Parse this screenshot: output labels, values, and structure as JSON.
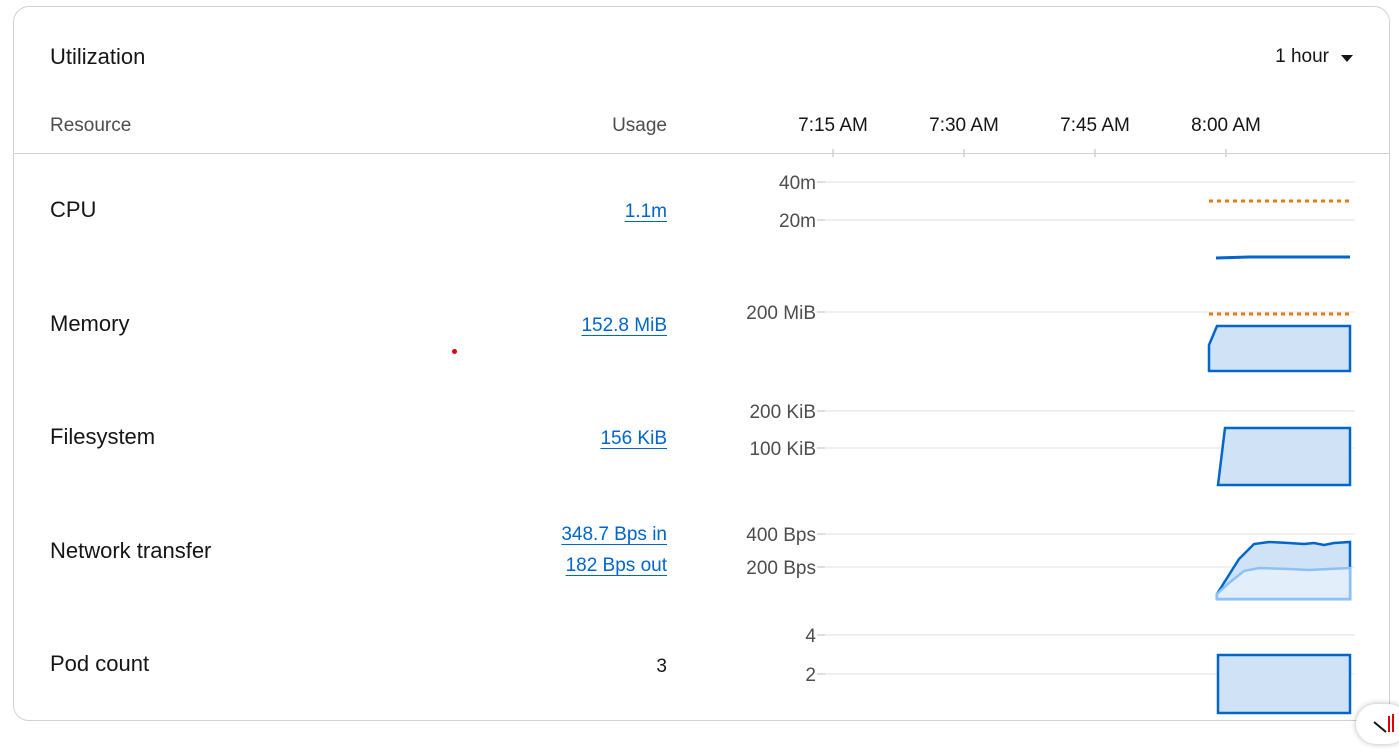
{
  "card": {
    "title": "Utilization",
    "duration": "1 hour"
  },
  "columns": {
    "resource": "Resource",
    "usage": "Usage"
  },
  "time_axis": {
    "ticks": [
      "7:15 AM",
      "7:30 AM",
      "7:45 AM",
      "8:00 AM"
    ]
  },
  "colors": {
    "series": "#0066cc",
    "series_fill": "#cfe2f6",
    "series_light": "#8bc1f7",
    "limit_line": "#ec7a08",
    "grid": "#e0e0e0",
    "link": "#0066cc"
  },
  "rows": [
    {
      "label": "CPU",
      "usage": [
        "1.1m"
      ],
      "usage_is_link": true,
      "y_ticks": [
        "40m",
        "20m"
      ]
    },
    {
      "label": "Memory",
      "usage": [
        "152.8 MiB"
      ],
      "usage_is_link": true,
      "y_ticks": [
        "200 MiB"
      ]
    },
    {
      "label": "Filesystem",
      "usage": [
        "156 KiB"
      ],
      "usage_is_link": true,
      "y_ticks": [
        "200 KiB",
        "100 KiB"
      ]
    },
    {
      "label": "Network transfer",
      "usage": [
        "348.7 Bps in",
        "182 Bps out"
      ],
      "usage_is_link": true,
      "y_ticks": [
        "400 Bps",
        "200 Bps"
      ]
    },
    {
      "label": "Pod count",
      "usage": [
        "3"
      ],
      "usage_is_link": false,
      "y_ticks": [
        "4",
        "2"
      ]
    }
  ]
}
